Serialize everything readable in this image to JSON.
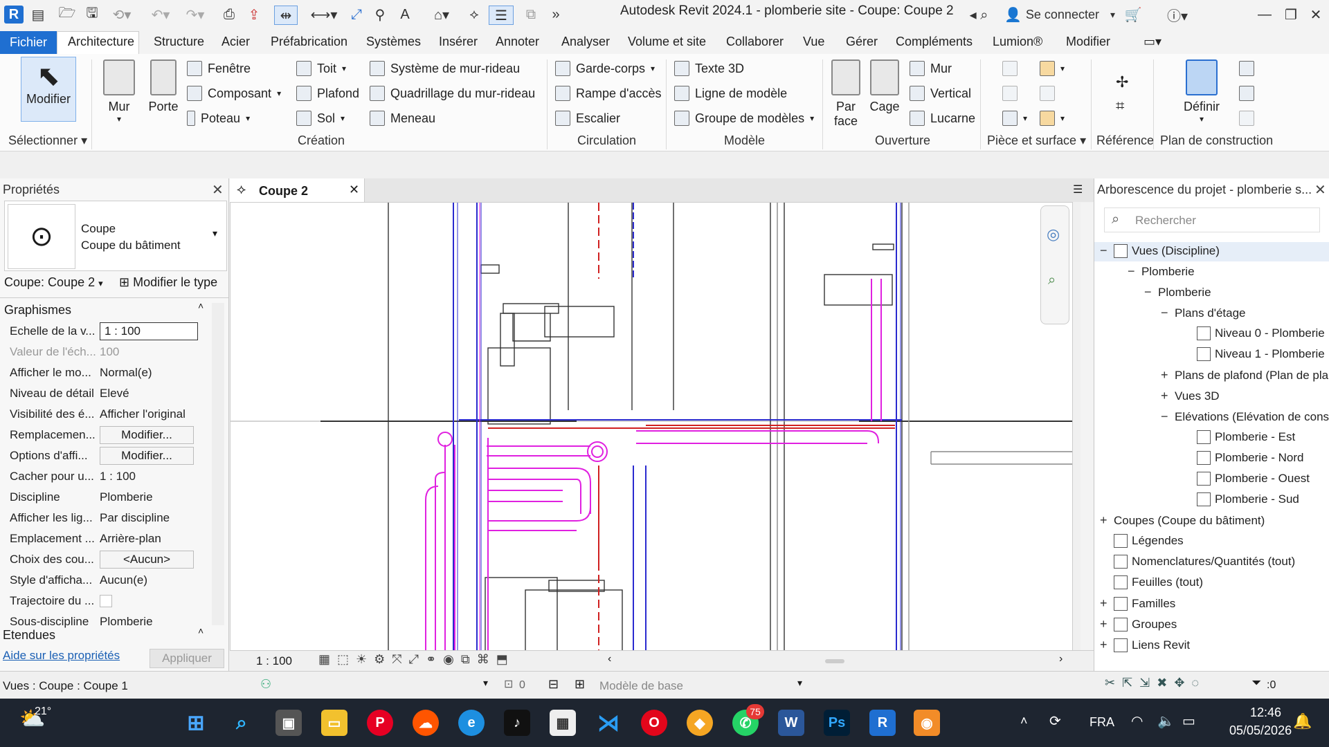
{
  "app": {
    "title": "Autodesk Revit 2024.1 - plomberie site - Coupe: Coupe 2",
    "logo": "R",
    "signin": "Se connecter"
  },
  "menu": {
    "file": "Fichier",
    "tabs": [
      "Architecture",
      "Structure",
      "Acier",
      "Préfabrication",
      "Systèmes",
      "Insérer",
      "Annoter",
      "Analyser",
      "Volume et site",
      "Collaborer",
      "Vue",
      "Gérer",
      "Compléments",
      "Lumion®",
      "Modifier"
    ]
  },
  "ribbon": {
    "modifier": "Modifier",
    "mur": "Mur",
    "porte": "Porte",
    "fenetre": "Fenêtre",
    "composant": "Composant",
    "poteau": "Poteau",
    "toit": "Toit",
    "plafond": "Plafond",
    "sol": "Sol",
    "systeme_mur_rideau": "Système de mur-rideau",
    "quadrillage": "Quadrillage du mur-rideau",
    "meneau": "Meneau",
    "garde_corps": "Garde-corps",
    "rampe": "Rampe d'accès",
    "escalier": "Escalier",
    "texte3d": "Texte 3D",
    "ligne_modele": "Ligne de modèle",
    "groupe_modeles": "Groupe de modèles",
    "par_face_1": "Par",
    "par_face_2": "face",
    "cage": "Cage",
    "mur_ouv": "Mur",
    "vertical": "Vertical",
    "lucarne": "Lucarne",
    "definir": "Définir",
    "panels": {
      "selectionner": "Sélectionner",
      "creation": "Création",
      "circulation": "Circulation",
      "modele": "Modèle",
      "ouverture": "Ouverture",
      "piece_surface": "Pièce et surface",
      "reference": "Référence",
      "plan_construction": "Plan de construction"
    }
  },
  "properties": {
    "title": "Propriétés",
    "type_line1": "Coupe",
    "type_line2": "Coupe du bâtiment",
    "selector": "Coupe: Coupe 2",
    "edit_type": "Modifier le type",
    "group_graphics": "Graphismes",
    "group_extents": "Etendues",
    "rows": [
      {
        "key": "Echelle de la v...",
        "value": "1 : 100"
      },
      {
        "key": "Valeur de l'éch...",
        "value": "100"
      },
      {
        "key": "Afficher le mo...",
        "value": "Normal(e)"
      },
      {
        "key": "Niveau de détail",
        "value": "Elevé"
      },
      {
        "key": "Visibilité des é...",
        "value": "Afficher l'original"
      },
      {
        "key": "Remplacemen...",
        "value": "Modifier..."
      },
      {
        "key": "Options d'affi...",
        "value": "Modifier..."
      },
      {
        "key": "Cacher pour u...",
        "value": "1 : 100"
      },
      {
        "key": "Discipline",
        "value": "Plomberie"
      },
      {
        "key": "Afficher les lig...",
        "value": "Par discipline"
      },
      {
        "key": "Emplacement ...",
        "value": "Arrière-plan"
      },
      {
        "key": "Choix des cou...",
        "value": "<Aucun>"
      },
      {
        "key": "Style d'afficha...",
        "value": "Aucun(e)"
      },
      {
        "key": "Trajectoire du ...",
        "value": ""
      },
      {
        "key": "Sous-discipline",
        "value": "Plomberie"
      }
    ],
    "help": "Aide sur les propriétés",
    "apply": "Appliquer"
  },
  "view": {
    "tab": "Coupe 2",
    "scale": "1 : 100"
  },
  "browser": {
    "title": "Arborescence du projet - plomberie s...",
    "search_placeholder": "Rechercher",
    "items": [
      {
        "label": "Vues (Discipline)",
        "toggle": "−"
      },
      {
        "label": "Plomberie",
        "toggle": "−"
      },
      {
        "label": "Plomberie",
        "toggle": "−"
      },
      {
        "label": "Plans d'étage",
        "toggle": "−"
      },
      {
        "label": "Niveau 0 - Plomberie",
        "toggle": ""
      },
      {
        "label": "Niveau 1 - Plomberie",
        "toggle": ""
      },
      {
        "label": "Plans de plafond (Plan de pla",
        "toggle": "+"
      },
      {
        "label": "Vues 3D",
        "toggle": "+"
      },
      {
        "label": "Elévations (Elévation de cons",
        "toggle": "−"
      },
      {
        "label": "Plomberie - Est",
        "toggle": ""
      },
      {
        "label": "Plomberie - Nord",
        "toggle": ""
      },
      {
        "label": "Plomberie - Ouest",
        "toggle": ""
      },
      {
        "label": "Plomberie - Sud",
        "toggle": ""
      },
      {
        "label": "Coupes (Coupe du bâtiment)",
        "toggle": "+"
      },
      {
        "label": "Légendes",
        "toggle": ""
      },
      {
        "label": "Nomenclatures/Quantités (tout)",
        "toggle": ""
      },
      {
        "label": "Feuilles (tout)",
        "toggle": ""
      },
      {
        "label": "Familles",
        "toggle": "+"
      },
      {
        "label": "Groupes",
        "toggle": "+"
      },
      {
        "label": "Liens Revit",
        "toggle": "+"
      }
    ]
  },
  "status": {
    "left": "Vues : Coupe : Coupe 1",
    "workset": "0",
    "model": "Modèle de base",
    "filter": ":0"
  },
  "taskbar": {
    "weather": "21°",
    "badge": "75",
    "lang": "FRA",
    "time": "12:46",
    "date": "05/05/2026"
  },
  "colors": {
    "accent": "#1f6fd1",
    "pipe_magenta": "#e020e0",
    "pipe_red": "#d02020",
    "pipe_blue": "#2a2acf"
  }
}
